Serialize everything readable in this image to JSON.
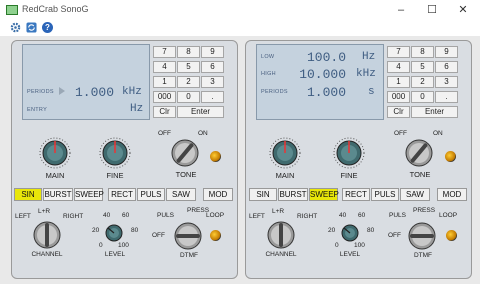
{
  "window": {
    "title": "RedCrab SonoG",
    "minimize": "–",
    "maximize": "☐",
    "close": "✕"
  },
  "toolbar": {
    "icons": [
      "gear-icon",
      "refresh-icon",
      "help-icon"
    ],
    "help_glyph": "?"
  },
  "keypad": {
    "keys": [
      "7",
      "8",
      "9",
      "4",
      "5",
      "6",
      "1",
      "2",
      "3",
      "000",
      "0",
      "."
    ],
    "clear": "Clr",
    "enter": "Enter"
  },
  "left": {
    "lcd": {
      "periods_label": "PERIODS",
      "value": "1.000",
      "unit": "kHz",
      "entry_label": "ENTRY",
      "entry_unit": "Hz"
    },
    "knobs": {
      "main": "MAIN",
      "fine": "FINE",
      "tone": "TONE",
      "off": "OFF",
      "on": "ON"
    },
    "wave": [
      "SIN",
      "BURST",
      "SWEEP"
    ],
    "wave_active": "SIN",
    "mod": [
      "RECT",
      "PULS",
      "SAW",
      "MOD"
    ],
    "channel": {
      "left": "LEFT",
      "lr": "L+R",
      "right": "RIGHT",
      "label": "CHANNEL"
    },
    "level": {
      "t40": "40",
      "t60": "60",
      "t20": "20",
      "t80": "80",
      "t0": "0",
      "t100": "100",
      "label": "LEVEL"
    },
    "dtmf": {
      "puls": "PULS",
      "press": "PRESS",
      "loop": "LOOP",
      "off": "OFF",
      "label": "DTMF"
    }
  },
  "right": {
    "lcd": {
      "low_label": "LOW",
      "low_value": "100.0",
      "low_unit": "Hz",
      "high_label": "HIGH",
      "high_value": "10.000",
      "high_unit": "kHz",
      "periods_label": "PERIODS",
      "periods_value": "1.000",
      "periods_unit": "s"
    },
    "knobs": {
      "main": "MAIN",
      "fine": "FINE",
      "tone": "TONE",
      "off": "OFF",
      "on": "ON"
    },
    "wave": [
      "SIN",
      "BURST",
      "SWEEP"
    ],
    "wave_active": "SWEEP",
    "mod": [
      "RECT",
      "PULS",
      "SAW",
      "MOD"
    ],
    "channel": {
      "left": "LEFT",
      "lr": "L+R",
      "right": "RIGHT",
      "label": "CHANNEL"
    },
    "level": {
      "t40": "40",
      "t60": "60",
      "t20": "20",
      "t80": "80",
      "t0": "0",
      "t100": "100",
      "label": "LEVEL"
    },
    "dtmf": {
      "puls": "PULS",
      "press": "PRESS",
      "loop": "LOOP",
      "off": "OFF",
      "label": "DTMF"
    }
  }
}
